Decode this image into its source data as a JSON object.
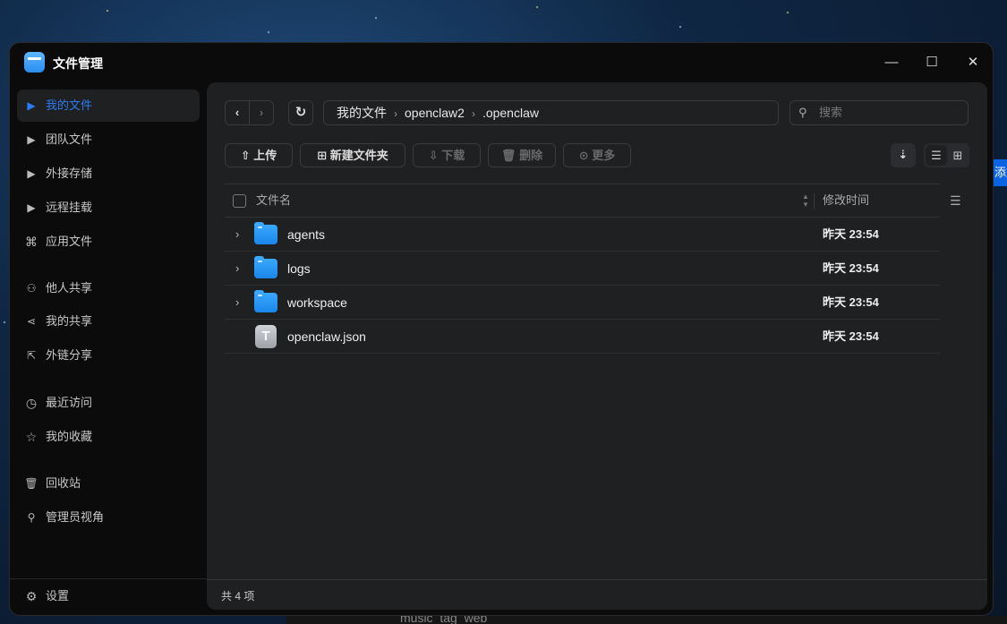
{
  "window": {
    "title": "文件管理",
    "controls": [
      "minimize",
      "maximize",
      "close"
    ]
  },
  "sidebar": {
    "items": [
      {
        "label": "我的文件",
        "icon": "caret-right-icon",
        "active": true
      },
      {
        "label": "团队文件",
        "icon": "caret-right-icon"
      },
      {
        "label": "外接存储",
        "icon": "caret-right-icon"
      },
      {
        "label": "远程挂载",
        "icon": "caret-right-icon"
      },
      {
        "label": "应用文件",
        "icon": "apps-icon"
      },
      {
        "label": "他人共享",
        "icon": "users-icon"
      },
      {
        "label": "我的共享",
        "icon": "share-icon"
      },
      {
        "label": "外链分享",
        "icon": "external-share-icon"
      },
      {
        "label": "最近访问",
        "icon": "clock-icon"
      },
      {
        "label": "我的收藏",
        "icon": "star-icon"
      },
      {
        "label": "回收站",
        "icon": "trash-icon"
      },
      {
        "label": "管理员视角",
        "icon": "admin-icon"
      }
    ],
    "settings": "设置"
  },
  "breadcrumb": [
    "我的文件",
    "openclaw2",
    ".openclaw"
  ],
  "search": {
    "placeholder": "搜索",
    "value": ""
  },
  "toolbar": {
    "upload": "上传",
    "new_folder": "新建文件夹",
    "download": "下载",
    "delete": "删除",
    "more": "更多"
  },
  "table": {
    "columns": [
      "文件名",
      "修改时间"
    ],
    "rows": [
      {
        "name": "agents",
        "type": "folder",
        "modified": "昨天 23:54"
      },
      {
        "name": "logs",
        "type": "folder",
        "modified": "昨天 23:54"
      },
      {
        "name": "workspace",
        "type": "folder",
        "modified": "昨天 23:54"
      },
      {
        "name": "openclaw.json",
        "type": "text-file",
        "modified": "昨天 23:54"
      }
    ]
  },
  "footer": {
    "count": "共 4 项"
  },
  "background": {
    "right_button": "添加",
    "bottom_item": "music_tag_web"
  },
  "colors": {
    "accent": "#2c7bf0",
    "panel": "#1f2022",
    "sidebar": "#0b0b0c"
  }
}
